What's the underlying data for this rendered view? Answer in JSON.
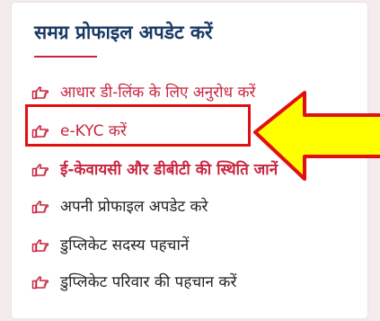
{
  "card": {
    "title": "समग्र प्रोफाइल अपडेट करें"
  },
  "links": [
    {
      "label": "आधार डी-लिंक के लिए अनुरोध करें",
      "icon": "hand-point-right-icon"
    },
    {
      "label": "e-KYC करें",
      "icon": "hand-point-right-icon"
    },
    {
      "label": "ई-केवायसी और डीबीटी की स्थिति जानें",
      "icon": "hand-point-right-icon"
    },
    {
      "label": "अपनी प्रोफाइल अपडेट करे",
      "icon": "hand-point-right-icon"
    },
    {
      "label": "डुप्लिकेट सदस्य पहचानें",
      "icon": "hand-point-right-icon"
    },
    {
      "label": "डुप्लिकेट परिवार की पहचान करें",
      "icon": "hand-point-right-icon"
    }
  ],
  "annotation": {
    "box_color": "#e01010",
    "arrow_color": "#ffff00",
    "arrow_outline_color": "#e01010"
  },
  "colors": {
    "title": "#1a3a66",
    "accent": "#c8253f",
    "text": "#222222"
  }
}
